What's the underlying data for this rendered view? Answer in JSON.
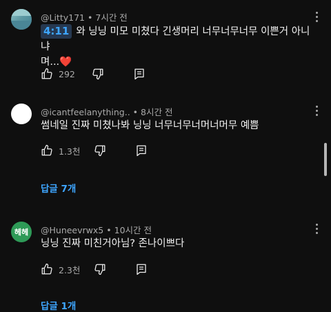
{
  "comments": [
    {
      "author": "@Litty171",
      "time": "7시간 전",
      "timestamp_link": "4:11",
      "text_line1": "와 닝닝 미모 미쳤다 긴생머리 너무너무너무 이쁜거 아니냐",
      "text_line2": "며...",
      "heart": "❤️",
      "likes": "292",
      "avatar_icon": "photo-avatar"
    },
    {
      "author": "@icantfeelanything..",
      "time": "8시간 전",
      "text": "썸네일 진짜 미쳤나봐 닝닝 너무너무너머너머무 예쁨",
      "likes": "1.3천",
      "replies": "답글 7개",
      "avatar_icon": "white-circle-avatar"
    },
    {
      "author": "@Huneevrwx5",
      "time": "10시간 전",
      "avatar_text": "헤헤",
      "text": "닝닝 진짜 미친거아님? 존나이쁘다",
      "likes": "2.3천",
      "replies": "답글 1개"
    }
  ],
  "colors": {
    "background": "#0f0f0f",
    "link": "#3ea6ff",
    "avatar_green": "#2e9a57",
    "heart": "#e0332e"
  },
  "icons": [
    "thumbs-up-icon",
    "thumbs-down-icon",
    "reply-icon",
    "more-vert-icon"
  ]
}
